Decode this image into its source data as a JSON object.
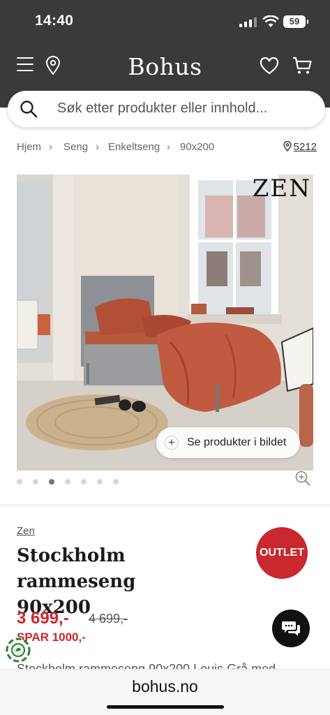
{
  "status": {
    "time": "14:40",
    "battery": "59"
  },
  "header": {
    "logo": "Bohus",
    "menu_icon": "hamburger-icon",
    "location_icon": "map-pin-icon",
    "wishlist_icon": "heart-icon",
    "cart_icon": "cart-icon"
  },
  "search": {
    "placeholder": "Søk etter produkter eller innhold..."
  },
  "breadcrumb": {
    "items": [
      "Hjem",
      "Seng",
      "Enkeltseng",
      "90x200"
    ],
    "store_number": "5212"
  },
  "gallery": {
    "brand_watermark": "ZEN",
    "shop_the_look_label": "Se produkter i bildet",
    "dot_count": 7,
    "active_dot": 3
  },
  "product": {
    "brand": "Zen",
    "title_line1": "Stockholm rammeseng",
    "title_line2": "90x200",
    "badge": "OUTLET",
    "price": "3 699,-",
    "old_price": "4 699,-",
    "savings": "SPAR 1000,-",
    "description_fragment": "Stockholm rammeseng 90x200 Louis Grå med"
  },
  "browser": {
    "url": "bohus.no"
  },
  "colors": {
    "header_bg": "#3a3a3c",
    "sale_red": "#c8282e"
  }
}
